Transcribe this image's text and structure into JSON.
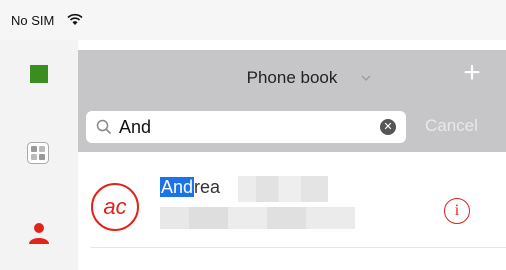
{
  "status_bar": {
    "carrier": "No SIM",
    "wifi_icon": "wifi-icon"
  },
  "sidebar": {
    "items": [
      {
        "icon": "green-square-icon",
        "color": "#3c8d1f"
      },
      {
        "icon": "grid-icon"
      },
      {
        "icon": "person-icon",
        "color": "#e2231a"
      }
    ]
  },
  "nav": {
    "title": "Phone book",
    "dropdown_icon": "chevron-down-icon",
    "add_icon": "plus-icon",
    "add_label": "+"
  },
  "search": {
    "query": "And",
    "cancel_label": "Cancel",
    "clear_label": "✕",
    "search_icon": "magnifier-icon"
  },
  "contacts": [
    {
      "avatar_initials": "ac",
      "name_match": "And",
      "name_rest": "rea",
      "info_label": "i"
    }
  ],
  "colors": {
    "accent": "#e2231a",
    "highlight": "#1a73e8",
    "nav_bg": "#c6c6c8"
  }
}
